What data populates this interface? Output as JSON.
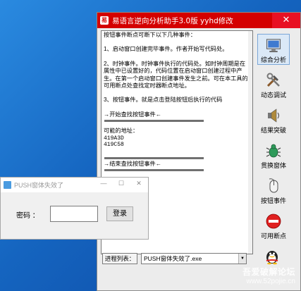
{
  "main_window": {
    "title": "易语言逆向分析助手3.0版 yyhd修改",
    "close": "✕",
    "logo": "易",
    "text_panel": {
      "heading": "按钮事件断点可断下以下几种事件：",
      "item1": "1、启动窗口创建完毕事件。作者开始写代码处。",
      "item2": "2、时钟事件。时钟事件执行的代码处。如时钟周期是在属性中已设置好的，代码位置在启动窗口创建过程中产生。在第一个启动窗口创建事件发生之前。可在本工具的可用断点处查找定时器断点地址。",
      "item3": "3、按钮事件。就是点击登陆按钮后执行的代码",
      "start_marker": "→开始查找按钮事件←",
      "address_heading": "可能的地址：",
      "addresses": [
        "419A3D",
        "419C58"
      ],
      "end_marker": "→结束查找按钮事件←"
    },
    "side_buttons": [
      {
        "label": "综合分析",
        "icon": "monitor-icon"
      },
      {
        "label": "动态调试",
        "icon": "tools-icon"
      },
      {
        "label": "结果突破",
        "icon": "speaker-icon"
      },
      {
        "label": "贯换窗体",
        "icon": "bug-icon"
      },
      {
        "label": "按钮事件",
        "icon": "mouse-icon"
      },
      {
        "label": "可用断点",
        "icon": "stop-icon"
      }
    ],
    "process_label": "进程列表：",
    "process_value": "PUSH窗体失效了.exe",
    "dropdown_arrow": "▼"
  },
  "push_window": {
    "title": "PUSH窗体失效了",
    "min": "—",
    "max": "☐",
    "close": "✕",
    "password_label": "密码 ：",
    "password_value": "",
    "login_button": "登录"
  },
  "watermark": {
    "title": "吾爱破解论坛",
    "url": "www.52pojie.cn"
  }
}
